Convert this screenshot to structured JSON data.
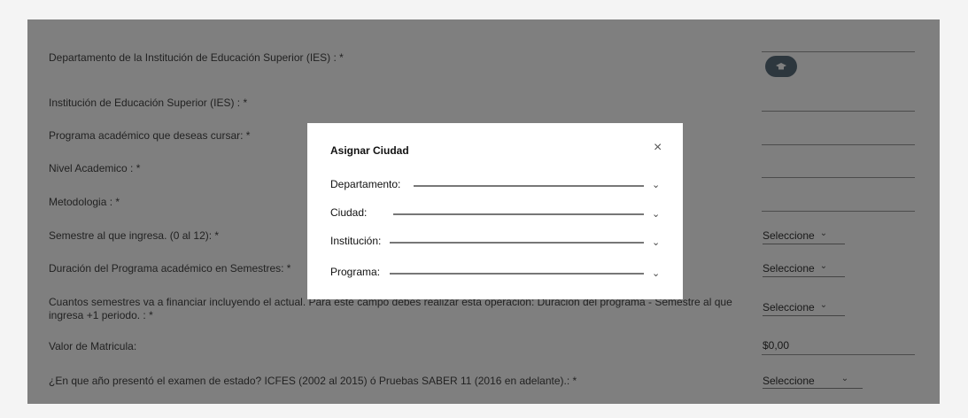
{
  "form": {
    "rows": [
      "Departamento de la Institución de Educación Superior (IES) : *",
      "Institución de Educación Superior (IES) : *",
      "Programa académico que deseas cursar: *",
      "Nivel Academico : *",
      "Metodologia : *",
      "Semestre al que ingresa. (0 al 12): *",
      "Duración del Programa académico en Semestres: *",
      "Cuantos semestres va a financiar incluyendo el actual. Para este campo debes realizar esta operación: Duración del programa - Semestre al que ingresa +1 periodo. : *",
      "Valor de Matricula:",
      "¿En que año presentó el examen de estado? ICFES (2002 al 2015) ó Pruebas SABER 11 (2016 en adelante).: *"
    ],
    "select_placeholder": "Seleccione",
    "tuition_value": "$0,00"
  },
  "modal": {
    "title": "Asignar Ciudad",
    "close": "×",
    "fields": [
      "Departamento:",
      "Ciudad:",
      "Institución:",
      "Programa:"
    ]
  },
  "icons": {
    "select_chevron": "chevron-down-icon",
    "graduation": "graduation-cap-icon"
  }
}
